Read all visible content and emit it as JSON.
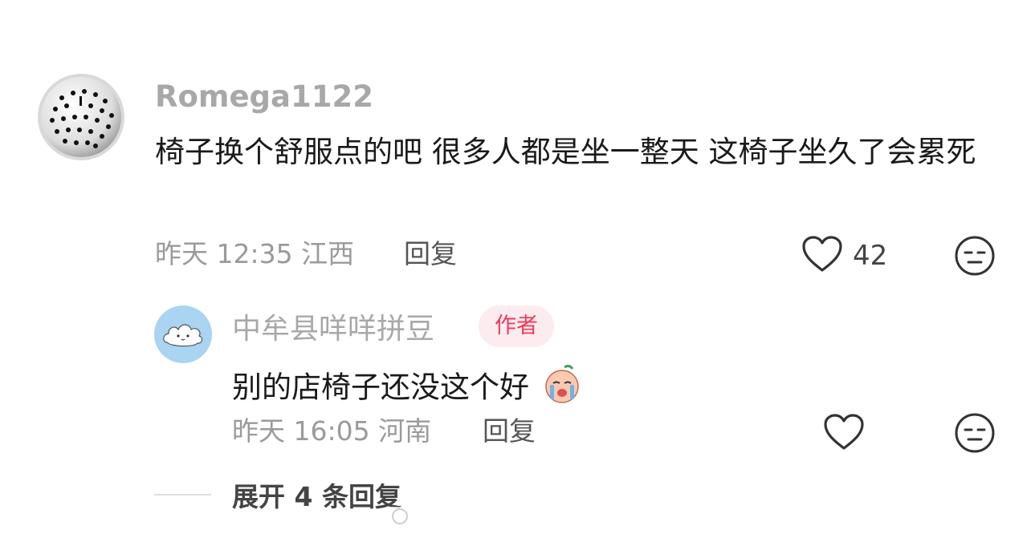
{
  "comment": {
    "username": "Romega1122",
    "text": "椅子换个舒服点的吧 很多人都是坐一整天 这椅子坐久了会累死",
    "time": "昨天 12:35",
    "location": "江西",
    "reply_label": "回复",
    "like_count": "42"
  },
  "reply": {
    "username": "中牟县咩咩拼豆",
    "badge": "作者",
    "text": "别的店椅子还没这个好",
    "time": "昨天 16:05",
    "location": "河南",
    "reply_label": "回复"
  },
  "expand_label": "展开 4 条回复",
  "colors": {
    "badge_bg": "#fdecef",
    "badge_text": "#ef3b5b",
    "meta_text": "#9a9a9a"
  },
  "icons": [
    "heart-icon",
    "emoji-face-icon",
    "crying-emoji-icon"
  ]
}
